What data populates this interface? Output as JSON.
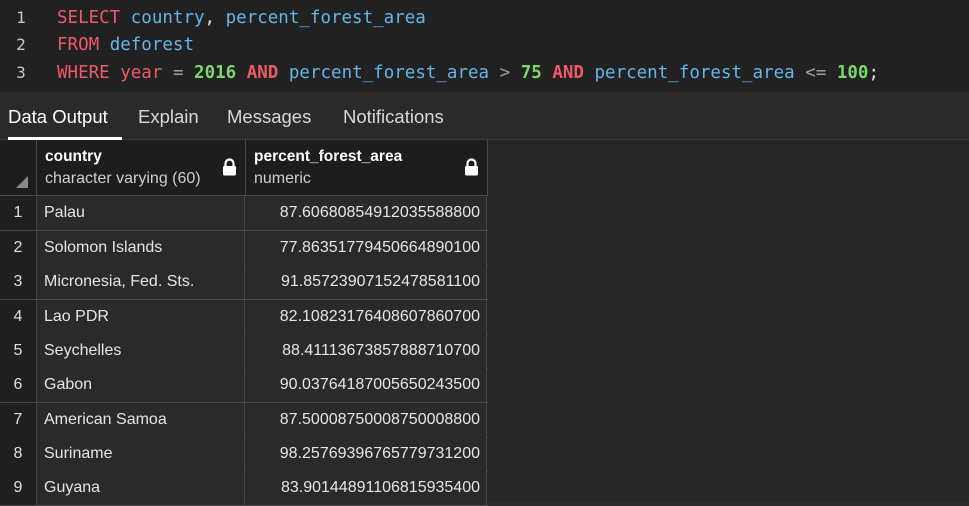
{
  "editor": {
    "lines": [
      {
        "num": "1",
        "tokens": {
          "kw": "SELECT",
          "a": "country",
          "comma": ",",
          "b": "percent_forest_area"
        }
      },
      {
        "num": "2",
        "tokens": {
          "kw": "FROM",
          "a": "deforest"
        }
      },
      {
        "num": "3",
        "tokens": {
          "kw": "WHERE",
          "a": "year",
          "op1": "=",
          "n1": "2016",
          "and1": "AND",
          "b": "percent_forest_area",
          "op2": ">",
          "n2": "75",
          "and2": "AND",
          "c": "percent_forest_area",
          "op3": "<=",
          "n3": "100",
          "semi": ";"
        }
      }
    ]
  },
  "tabs": [
    {
      "label": "Data Output",
      "active": true
    },
    {
      "label": "Explain",
      "active": false
    },
    {
      "label": "Messages",
      "active": false
    },
    {
      "label": "Notifications",
      "active": false
    }
  ],
  "grid": {
    "columns": [
      {
        "name": "country",
        "type": "character varying (60)",
        "icon": "lock-icon"
      },
      {
        "name": "percent_forest_area",
        "type": "numeric",
        "icon": "lock-icon"
      }
    ],
    "rows": [
      {
        "n": "1",
        "country": "Palau",
        "pct": "87.6068085491203558880​0"
      },
      {
        "n": "2",
        "country": "Solomon Islands",
        "pct": "77.8635177945066489010​0"
      },
      {
        "n": "3",
        "country": "Micronesia, Fed. Sts.",
        "pct": "91.8572390715247858110​0"
      },
      {
        "n": "4",
        "country": "Lao PDR",
        "pct": "82.1082317640860786070​0"
      },
      {
        "n": "5",
        "country": "Seychelles",
        "pct": "88.4111367385788871070​0"
      },
      {
        "n": "6",
        "country": "Gabon",
        "pct": "90.0376418700565024350​0"
      },
      {
        "n": "7",
        "country": "American Samoa",
        "pct": "87.5000875000875000880​0"
      },
      {
        "n": "8",
        "country": "Suriname",
        "pct": "98.2576939676577973120​0"
      },
      {
        "n": "9",
        "country": "Guyana",
        "pct": "83.9014489110681593540​0"
      }
    ]
  },
  "colors": {
    "keyword": "#ef5a6b",
    "identifier": "#63b6ea",
    "number": "#7bd66c",
    "background": "#2b2b2b"
  }
}
